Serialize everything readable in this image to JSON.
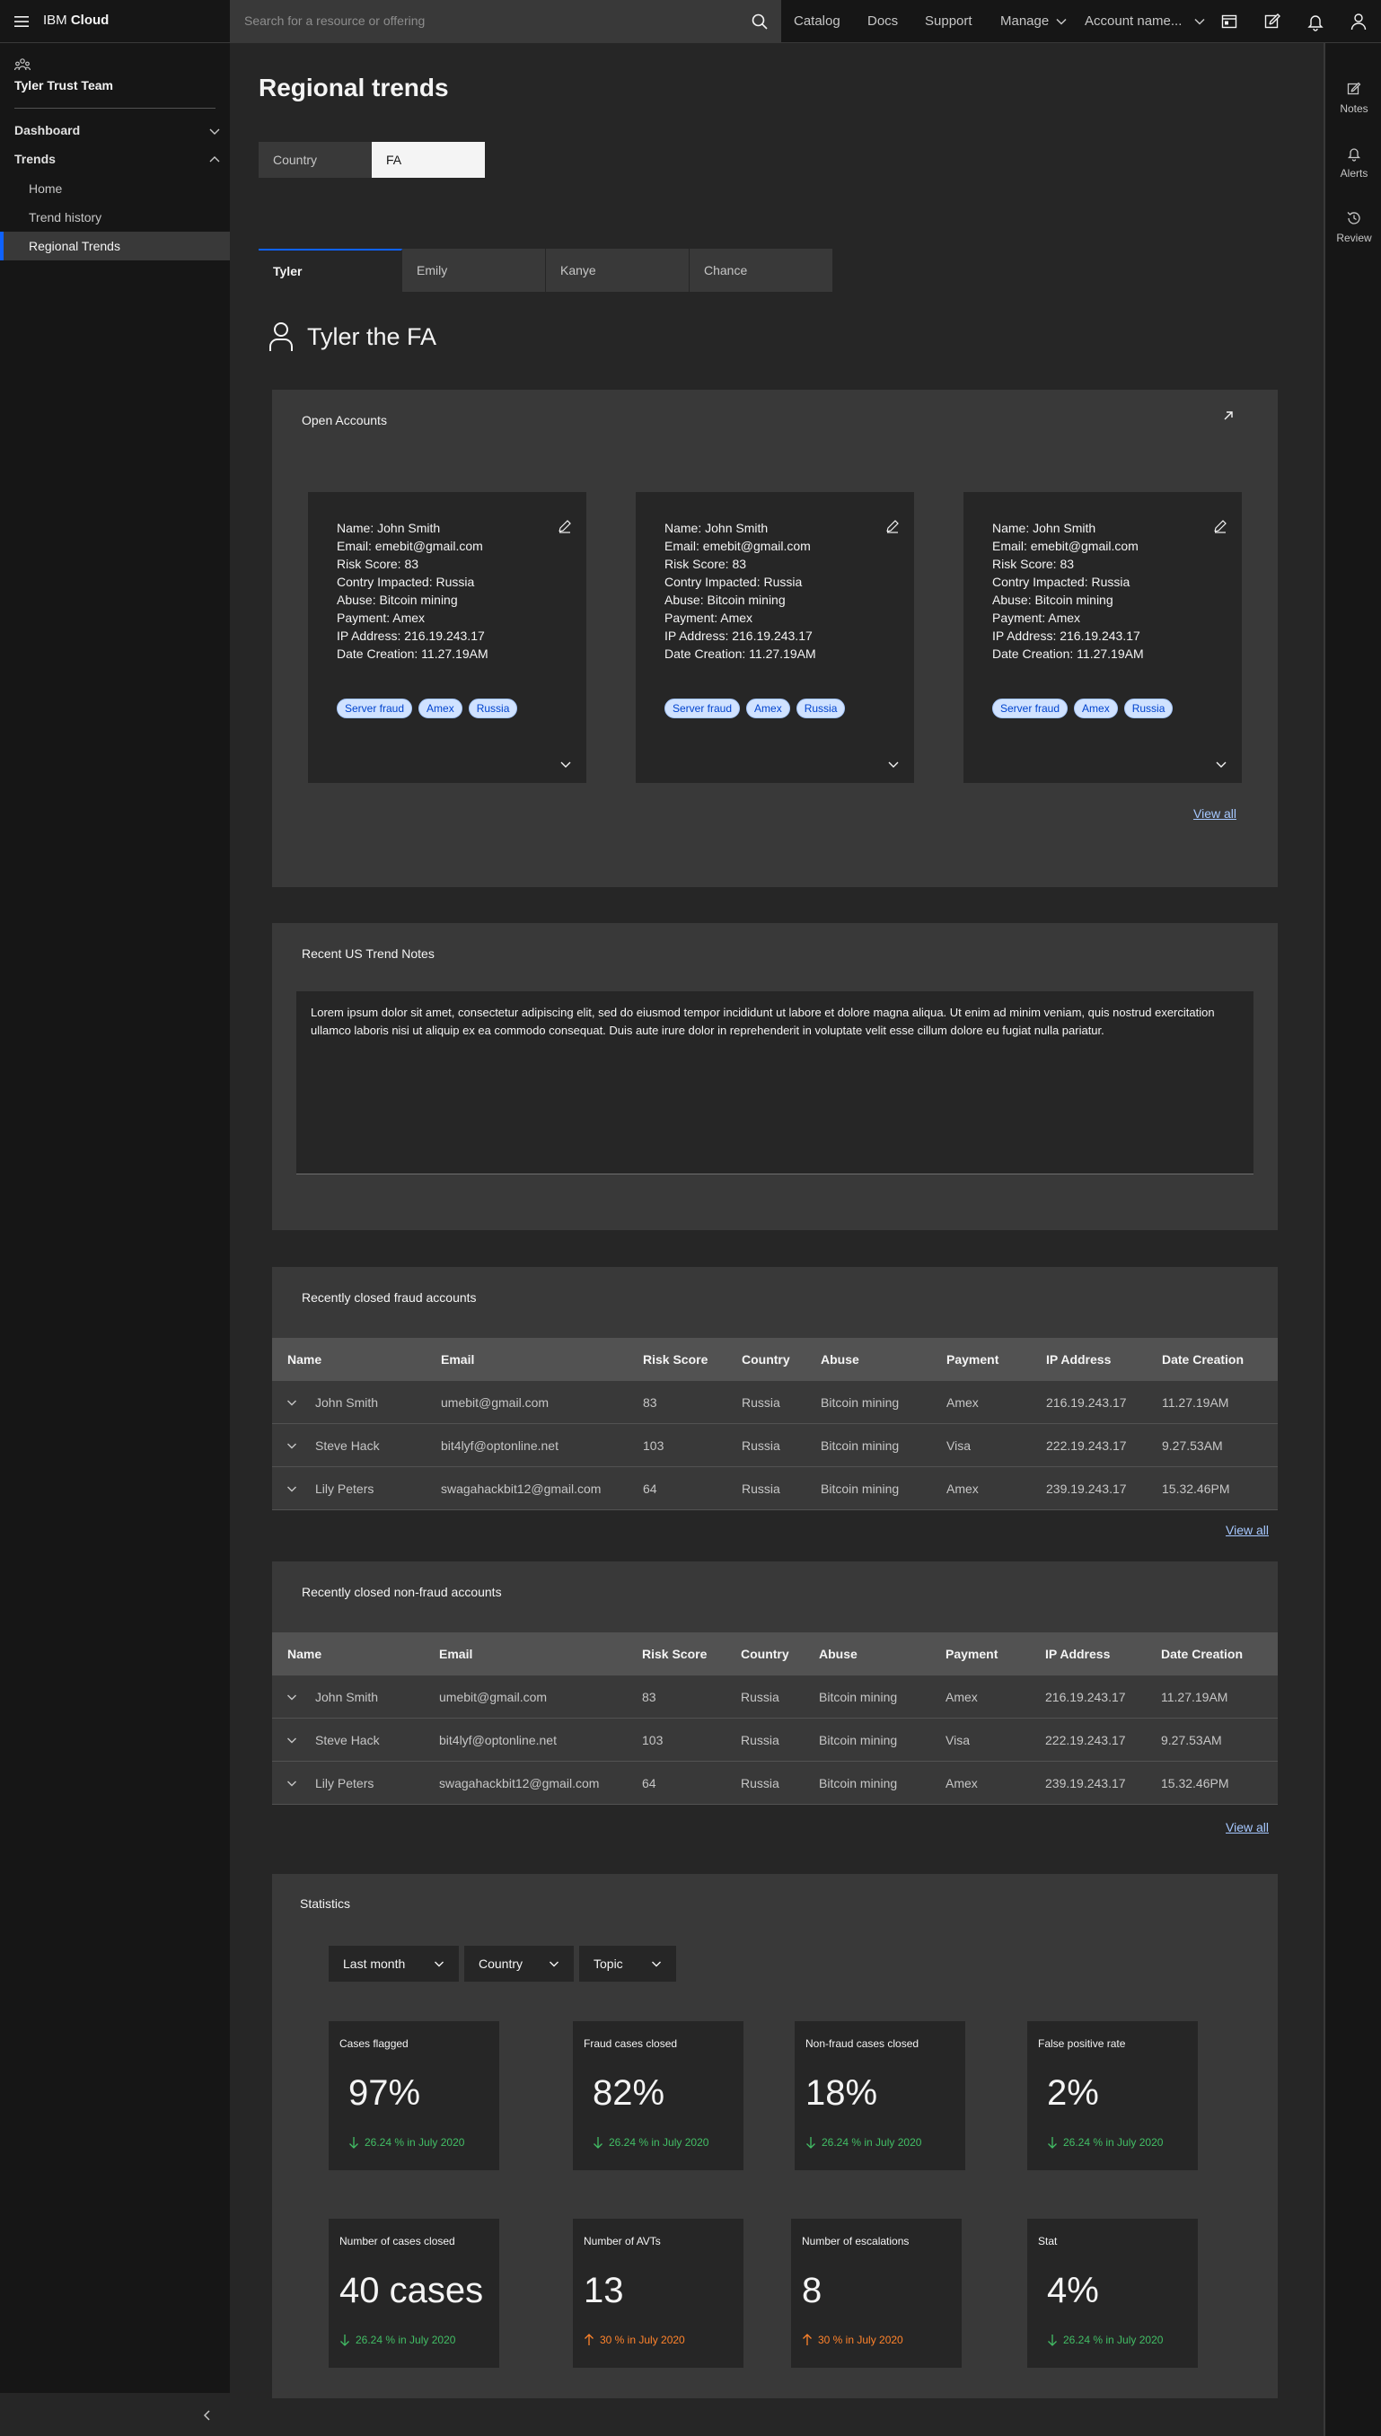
{
  "header": {
    "brand_prefix": "IBM",
    "brand_name": "Cloud",
    "search_placeholder": "Search for a resource or offering",
    "nav": [
      "Catalog",
      "Docs",
      "Support",
      "Manage",
      "Account name..."
    ]
  },
  "sidebar": {
    "team": "Tyler Trust Team",
    "sections": [
      {
        "label": "Dashboard"
      },
      {
        "label": "Trends",
        "items": [
          "Home",
          "Trend history",
          "Regional Trends"
        ]
      }
    ]
  },
  "right_rail": [
    "Notes",
    "Alerts",
    "Review"
  ],
  "page": {
    "title": "Regional trends",
    "switcher": [
      "Country",
      "FA"
    ],
    "tabs": [
      "Tyler",
      "Emily",
      "Kanye",
      "Chance"
    ],
    "fa_title": "Tyler the FA"
  },
  "open_accounts": {
    "title": "Open Accounts",
    "view_all": "View all",
    "cards": [
      {
        "lines": [
          "Name: John Smith",
          "Email: emebit@gmail.com",
          "Risk Score: 83",
          "Contry Impacted: Russia",
          "Abuse: Bitcoin mining",
          "Payment: Amex",
          "IP Address: 216.19.243.17",
          "Date Creation: 11.27.19AM"
        ],
        "tags": [
          "Server fraud",
          "Amex",
          "Russia"
        ]
      },
      {
        "lines": [
          "Name: John Smith",
          "Email: emebit@gmail.com",
          "Risk Score: 83",
          "Contry Impacted: Russia",
          "Abuse: Bitcoin mining",
          "Payment: Amex",
          "IP Address: 216.19.243.17",
          "Date Creation: 11.27.19AM"
        ],
        "tags": [
          "Server fraud",
          "Amex",
          "Russia"
        ]
      },
      {
        "lines": [
          "Name: John Smith",
          "Email: emebit@gmail.com",
          "Risk Score: 83",
          "Contry Impacted: Russia",
          "Abuse: Bitcoin mining",
          "Payment: Amex",
          "IP Address: 216.19.243.17",
          "Date Creation: 11.27.19AM"
        ],
        "tags": [
          "Server fraud",
          "Amex",
          "Russia"
        ]
      }
    ]
  },
  "notes": {
    "title": "Recent US Trend Notes",
    "text": "Lorem ipsum dolor sit amet, consectetur adipiscing elit, sed do eiusmod tempor incididunt ut labore et dolore magna aliqua. Ut enim ad minim veniam, quis nostrud exercitation ullamco laboris nisi ut aliquip ex ea commodo consequat. Duis aute irure dolor in reprehenderit in voluptate velit esse cillum dolore eu fugiat nulla pariatur."
  },
  "fraud_table": {
    "title": "Recently closed fraud accounts",
    "view_all": "View all",
    "columns": [
      "Name",
      "Email",
      "Risk Score",
      "Country",
      "Abuse",
      "Payment",
      "IP Address",
      "Date Creation"
    ],
    "rows": [
      [
        "John Smith",
        "umebit@gmail.com",
        "83",
        "Russia",
        "Bitcoin mining",
        "Amex",
        "216.19.243.17",
        "11.27.19AM"
      ],
      [
        "Steve Hack",
        "bit4lyf@optonline.net",
        "103",
        "Russia",
        "Bitcoin mining",
        "Visa",
        "222.19.243.17",
        "9.27.53AM"
      ],
      [
        "Lily Peters",
        "swagahackbit12@gmail.com",
        "64",
        "Russia",
        "Bitcoin mining",
        "Amex",
        "239.19.243.17",
        "15.32.46PM"
      ]
    ]
  },
  "nonfraud_table": {
    "title": "Recently closed non-fraud accounts",
    "view_all": "View all",
    "columns": [
      "Name",
      "Email",
      "Risk Score",
      "Country",
      "Abuse",
      "Payment",
      "IP Address",
      "Date Creation"
    ],
    "rows": [
      [
        "John Smith",
        "umebit@gmail.com",
        "83",
        "Russia",
        "Bitcoin mining",
        "Amex",
        "216.19.243.17",
        "11.27.19AM"
      ],
      [
        "Steve Hack",
        "bit4lyf@optonline.net",
        "103",
        "Russia",
        "Bitcoin mining",
        "Visa",
        "222.19.243.17",
        "9.27.53AM"
      ],
      [
        "Lily Peters",
        "swagahackbit12@gmail.com",
        "64",
        "Russia",
        "Bitcoin mining",
        "Amex",
        "239.19.243.17",
        "15.32.46PM"
      ]
    ]
  },
  "statistics": {
    "title": "Statistics",
    "filters": [
      "Last month",
      "Country",
      "Topic"
    ],
    "tiles": [
      {
        "label": "Cases flagged",
        "value": "97%",
        "trend": "26.24 % in July 2020",
        "dir": "down"
      },
      {
        "label": "Fraud cases closed",
        "value": "82%",
        "trend": "26.24 % in July 2020",
        "dir": "down"
      },
      {
        "label": "Non-fraud cases closed",
        "value": "18%",
        "trend": "26.24 % in July 2020",
        "dir": "down"
      },
      {
        "label": "False positive rate",
        "value": "2%",
        "trend": "26.24 % in July 2020",
        "dir": "down"
      },
      {
        "label": "Number of cases closed",
        "value": "40 cases",
        "trend": "26.24 % in July 2020",
        "dir": "down"
      },
      {
        "label": "Number of AVTs",
        "value": "13",
        "trend": "30 % in July 2020",
        "dir": "up"
      },
      {
        "label": "Number of escalations",
        "value": "8",
        "trend": "30 % in July 2020",
        "dir": "up"
      },
      {
        "label": "Stat",
        "value": "4%",
        "trend": "26.24 % in July 2020",
        "dir": "down"
      }
    ]
  },
  "colors": {
    "accent": "#0f62fe",
    "down": "#42be65",
    "up": "#ff832b",
    "tag_bg": "#d0e2ff",
    "tag_text": "#0043ce"
  },
  "icons": [
    "menu-icon",
    "search-icon",
    "chevron-down-icon",
    "switcher-icon",
    "edit-icon",
    "notification-icon",
    "user-icon",
    "team-icon",
    "arrow-up-right-icon",
    "arrow-down-icon",
    "arrow-up-icon",
    "chevron-left-icon",
    "recent-icon"
  ]
}
